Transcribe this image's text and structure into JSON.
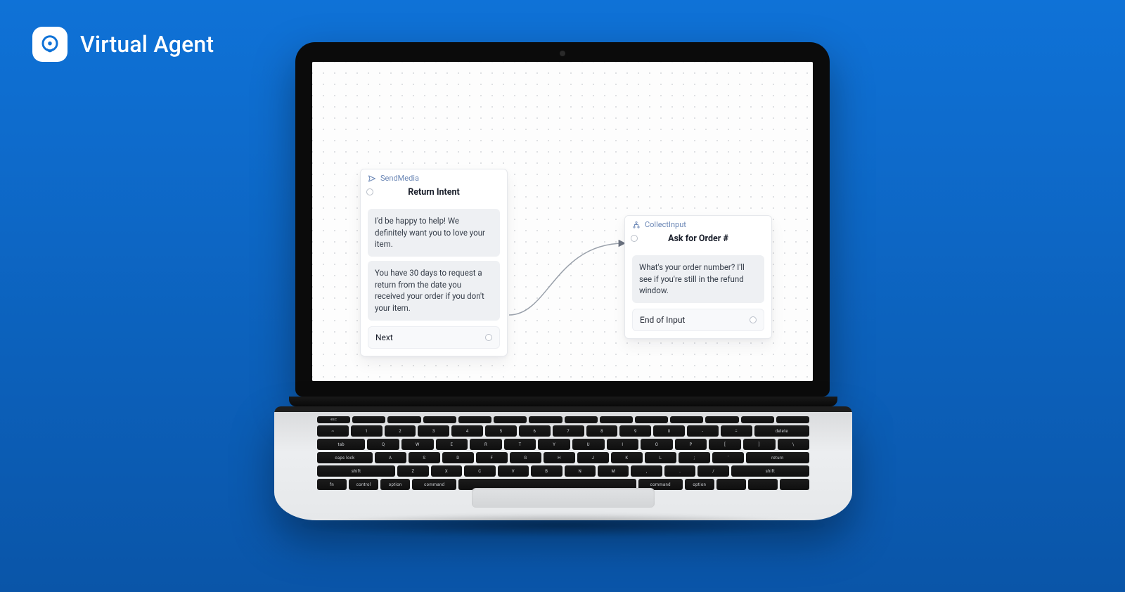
{
  "brand": {
    "title": "Virtual Agent"
  },
  "flow": {
    "nodes": {
      "sendMedia": {
        "type": "SendMedia",
        "title": "Return Intent",
        "messages": [
          "I'd be happy to help! We definitely want you to love your item.",
          "You have 30 days to request a return from the date you received your order if you don't your item."
        ],
        "action": "Next"
      },
      "collectInput": {
        "type": "CollectInput",
        "title": "Ask for Order #",
        "messages": [
          "What's your order number? I'll see if you're still in the refund window."
        ],
        "action": "End of Input"
      }
    }
  }
}
